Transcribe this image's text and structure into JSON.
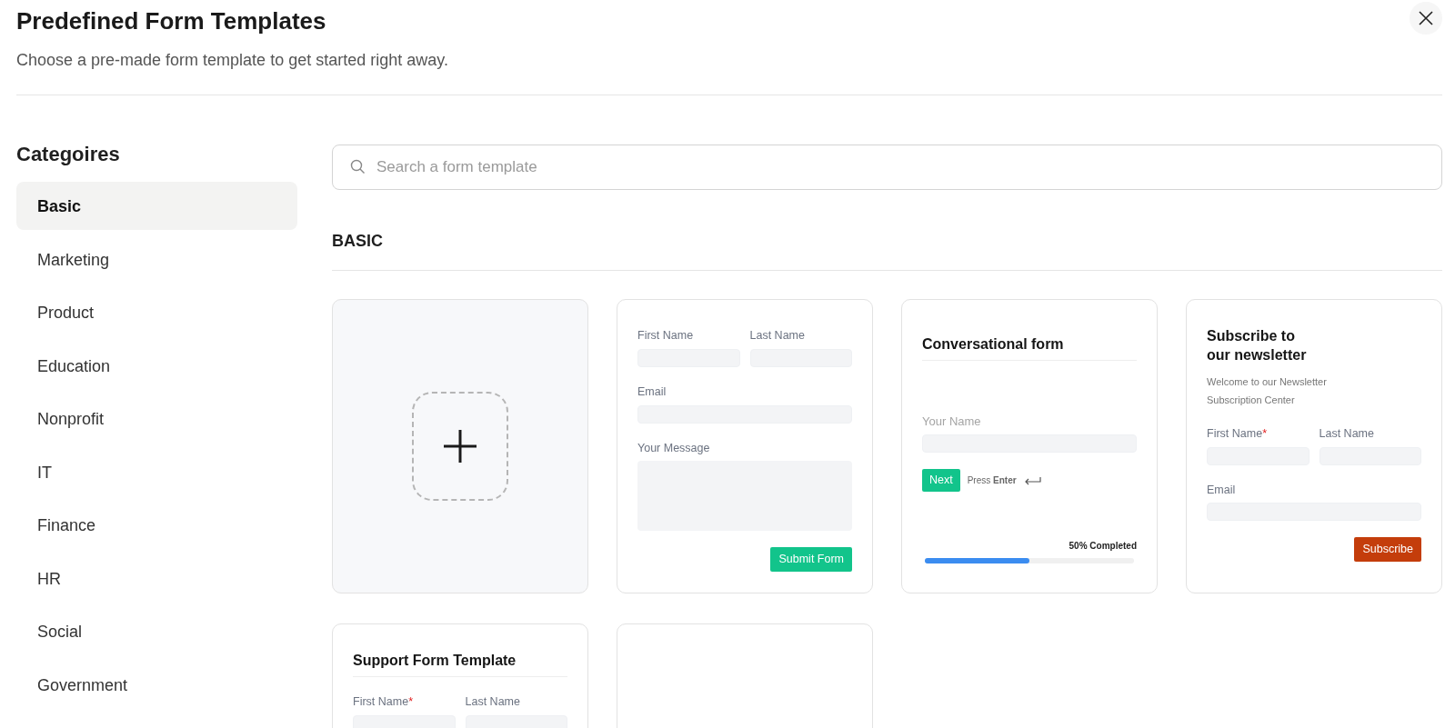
{
  "window": {
    "title": "Predefined Form Templates",
    "subtitle": "Choose a pre-made form template to get started right away."
  },
  "sidebar": {
    "heading": "Categoires",
    "items": [
      {
        "label": "Basic",
        "selected": true
      },
      {
        "label": "Marketing",
        "selected": false
      },
      {
        "label": "Product",
        "selected": false
      },
      {
        "label": "Education",
        "selected": false
      },
      {
        "label": "Nonprofit",
        "selected": false
      },
      {
        "label": "IT",
        "selected": false
      },
      {
        "label": "Finance",
        "selected": false
      },
      {
        "label": "HR",
        "selected": false
      },
      {
        "label": "Social",
        "selected": false
      },
      {
        "label": "Government",
        "selected": false
      }
    ]
  },
  "search": {
    "placeholder": "Search a form template"
  },
  "section": {
    "title": "BASIC",
    "templates": [
      {
        "kind": "blank"
      },
      {
        "kind": "form",
        "rows": [
          [
            {
              "label": "First Name",
              "kind": "input"
            },
            {
              "label": "Last Name",
              "kind": "input"
            }
          ],
          [
            {
              "label": "Email",
              "kind": "input"
            }
          ],
          [
            {
              "label": "Your Message",
              "kind": "textarea"
            }
          ]
        ],
        "button": {
          "label": "Submit Form",
          "color": "#12c48b"
        }
      },
      {
        "kind": "conversational",
        "title": "Conversational form",
        "field": "Your Name",
        "button": "Next",
        "hint": "Press **Enter**",
        "progress_label": "50% Completed",
        "level": 0.5
      },
      {
        "kind": "form",
        "title": "Subscribe to\nour newsletter",
        "intro": "Welcome to our Newsletter Subscription Center",
        "rows": [
          [
            {
              "label": "First Name",
              "mark": "*",
              "kind": "input"
            },
            {
              "label": "Last Name",
              "kind": "input"
            }
          ],
          [
            {
              "label": "Email",
              "kind": "input"
            }
          ]
        ],
        "button": {
          "label": "Subscribe",
          "color": "#c43d0b"
        }
      },
      {
        "kind": "form",
        "title": "Support Form Template",
        "divider": true,
        "rows": [
          [
            {
              "label": "First Name",
              "mark": "*",
              "kind": "input"
            },
            {
              "label": "Last Name",
              "kind": "input"
            }
          ]
        ]
      },
      {
        "kind": "empty"
      }
    ]
  }
}
